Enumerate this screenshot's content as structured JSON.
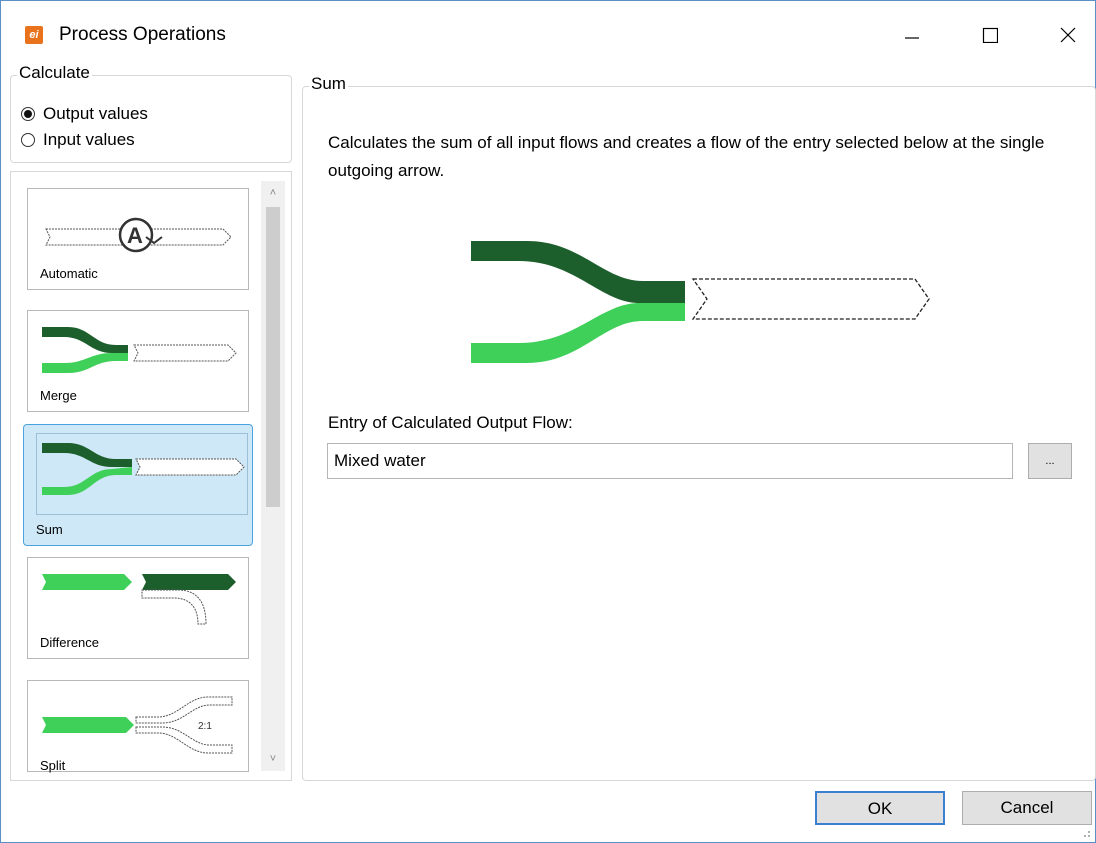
{
  "window": {
    "title": "Process Operations",
    "icon": "ei-app-icon"
  },
  "calculate": {
    "legend": "Calculate",
    "options": [
      {
        "label": "Output values",
        "checked": true
      },
      {
        "label": "Input values",
        "checked": false
      }
    ]
  },
  "operations": [
    {
      "label": "Automatic"
    },
    {
      "label": "Merge"
    },
    {
      "label": "Sum",
      "selected": true
    },
    {
      "label": "Difference"
    },
    {
      "label": "Split",
      "ratio": "2:1"
    }
  ],
  "detail": {
    "legend": "Sum",
    "description": "Calculates the sum of all input flows and creates a flow of the entry selected below at the single outgoing arrow.",
    "entry_label": "Entry of Calculated Output Flow:",
    "entry_value": "Mixed water",
    "browse_label": "..."
  },
  "buttons": {
    "ok": "OK",
    "cancel": "Cancel"
  },
  "colors": {
    "dark_green": "#1c5e2c",
    "light_green": "#3fd05a",
    "selection": "#cfe8f7",
    "accent": "#3c7fd1"
  }
}
